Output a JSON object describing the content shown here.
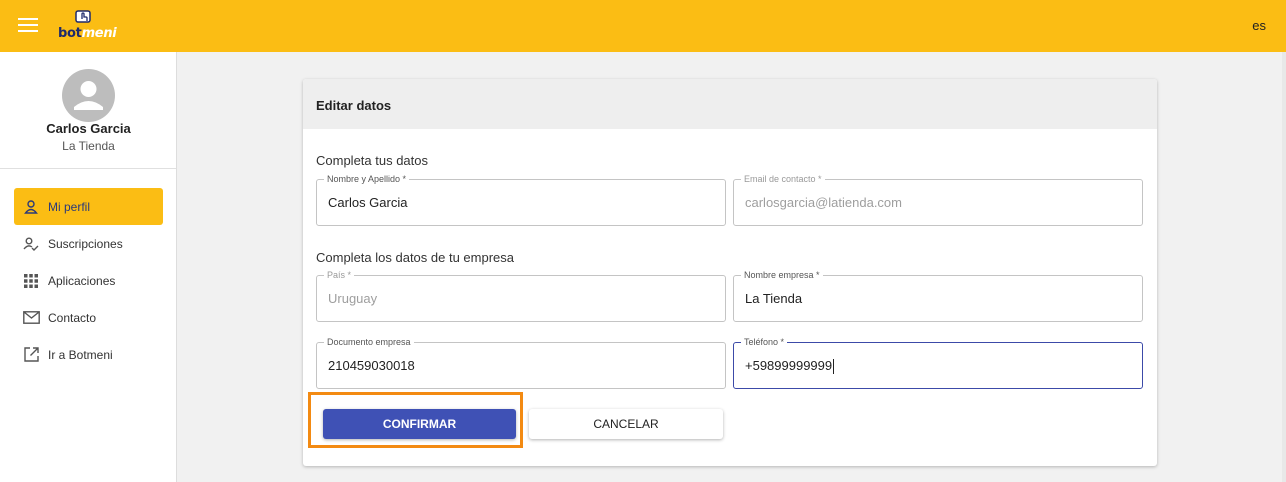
{
  "app": {
    "brand_part1": "bot",
    "brand_part2": "meni",
    "language": "es",
    "accent": "#fbbd14",
    "primary": "#3f51b5"
  },
  "user": {
    "name": "Carlos Garcia",
    "store": "La Tienda"
  },
  "sidebar": {
    "items": [
      {
        "label": "Mi perfil",
        "icon": "person-icon",
        "active": true
      },
      {
        "label": "Suscripciones",
        "icon": "person-check-icon"
      },
      {
        "label": "Aplicaciones",
        "icon": "apps-grid-icon"
      },
      {
        "label": "Contacto",
        "icon": "mail-icon"
      },
      {
        "label": "Ir a Botmeni",
        "icon": "external-link-icon"
      }
    ]
  },
  "form": {
    "title": "Editar datos",
    "section_personal": "Completa tus datos",
    "section_company": "Completa los datos de tu empresa",
    "fields": {
      "nombre": {
        "label": "Nombre y Apellido *",
        "value": "Carlos Garcia"
      },
      "email": {
        "label": "Email de contacto *",
        "value": "carlosgarcia@latienda.com"
      },
      "pais": {
        "label": "País *",
        "value": "Uruguay"
      },
      "empresa": {
        "label": "Nombre empresa *",
        "value": "La Tienda"
      },
      "documento": {
        "label": "Documento empresa",
        "value": "210459030018"
      },
      "telefono": {
        "label": "Teléfono *",
        "value": "+59899999999"
      }
    },
    "confirm_label": "CONFIRMAR",
    "cancel_label": "CANCELAR"
  }
}
